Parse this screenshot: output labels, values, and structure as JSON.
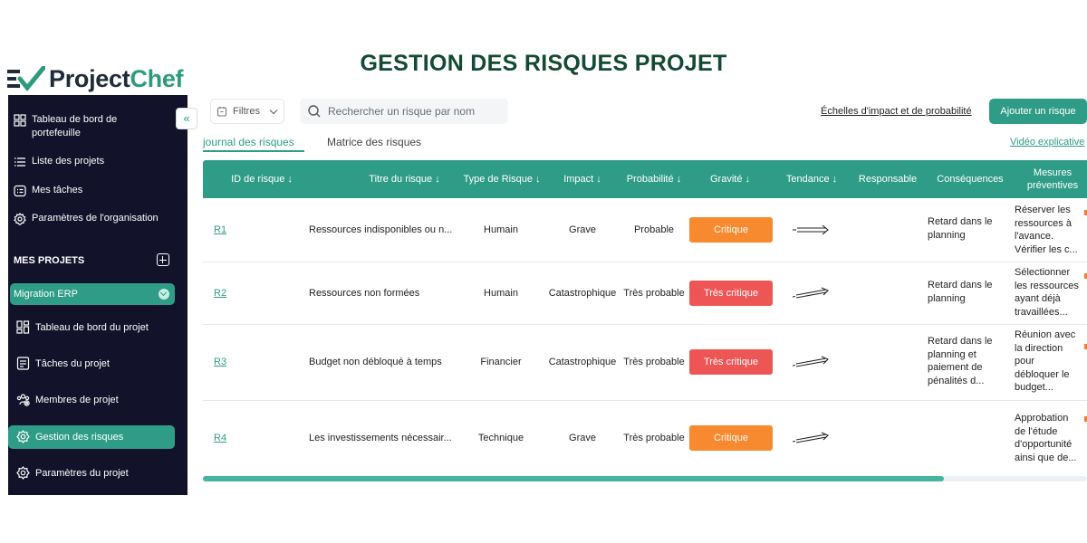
{
  "page_title": "GESTION DES RISQUES PROJET",
  "logo": {
    "part1": "Project",
    "part2": "Chef"
  },
  "sidebar": {
    "nav": [
      {
        "label_line1": "Tableau de bord de",
        "label_line2": "portefeuille",
        "icon": "grid-icon"
      },
      {
        "label": "Liste des projets",
        "icon": "list-icon"
      },
      {
        "label": "Mes tâches",
        "icon": "tasks-icon"
      },
      {
        "label": "Paramètres de l'organisation",
        "icon": "gear-icon"
      }
    ],
    "section_title": "MES PROJETS",
    "current_project": "Migration ERP",
    "project_nav": [
      {
        "label": "Tableau de bord du projet",
        "icon": "dashboard-icon"
      },
      {
        "label": "Tâches du projet",
        "icon": "checklist-icon"
      },
      {
        "label": "Membres de projet",
        "icon": "members-icon"
      },
      {
        "label": "Gestion des risques",
        "icon": "risk-icon"
      },
      {
        "label": "Paramètres du projet",
        "icon": "settings-icon"
      }
    ],
    "collapse_glyph": "«"
  },
  "toolbar": {
    "filter_label": "Filtres",
    "search_placeholder": "Rechercher un risque par nom",
    "scales_link": "Échelles d'impact et de probabilité",
    "add_button": "Ajouter un risque"
  },
  "tabs": {
    "journal": "journal des risques",
    "matrix": "Matrice des risques",
    "video": "Vidéo explicative"
  },
  "table": {
    "headers": {
      "id": "ID de risque ↓",
      "title": "Titre du risque ↓",
      "type": "Type de Risque ↓",
      "impact": "Impact ↓",
      "probability": "Probabilité ↓",
      "severity": "Gravité ↓",
      "trend": "Tendance ↓",
      "owner": "Responsable",
      "consequences": "Conséquences",
      "measures_1": "Mesures",
      "measures_2": "préventives"
    },
    "rows": [
      {
        "id": "R1",
        "title": "Ressources indisponibles ou n...",
        "type": "Humain",
        "impact": "Grave",
        "probability": "Probable",
        "severity": "Critique",
        "severity_color": "#f7892f",
        "consequences": [
          "Retard dans le",
          "planning"
        ],
        "measures": [
          "Réserver les",
          "ressources à",
          "l'avance.",
          "Vérifier les c..."
        ]
      },
      {
        "id": "R2",
        "title": "Ressources non formées",
        "type": "Humain",
        "impact": "Catastrophique",
        "probability": "Très probable",
        "severity": "Très critique",
        "severity_color": "#ee5656",
        "consequences": [
          "Retard dans le",
          "planning"
        ],
        "measures": [
          "Sélectionner",
          "les ressources",
          "ayant déjà",
          "travaillées..."
        ]
      },
      {
        "id": "R3",
        "title": "Budget non débloqué à temps",
        "type": "Financier",
        "impact": "Catastrophique",
        "probability": "Très probable",
        "severity": "Très critique",
        "severity_color": "#ee5656",
        "consequences": [
          "Retard dans le",
          "planning et",
          "paiement de",
          "pénalités d..."
        ],
        "measures": [
          "Réunion avec",
          "la direction",
          "pour",
          "débloquer le",
          "budget..."
        ]
      },
      {
        "id": "R4",
        "title": "Les investissements nécessair...",
        "type": "Technique",
        "impact": "Grave",
        "probability": "Très probable",
        "severity": "Critique",
        "severity_color": "#f7892f",
        "consequences": [],
        "measures": [
          "Approbation",
          "de l'étude",
          "d'opportunité",
          "ainsi que de..."
        ]
      }
    ]
  },
  "colors": {
    "accent": "#2e9c86",
    "sidebar_bg": "#12122a",
    "title": "#124a33"
  }
}
